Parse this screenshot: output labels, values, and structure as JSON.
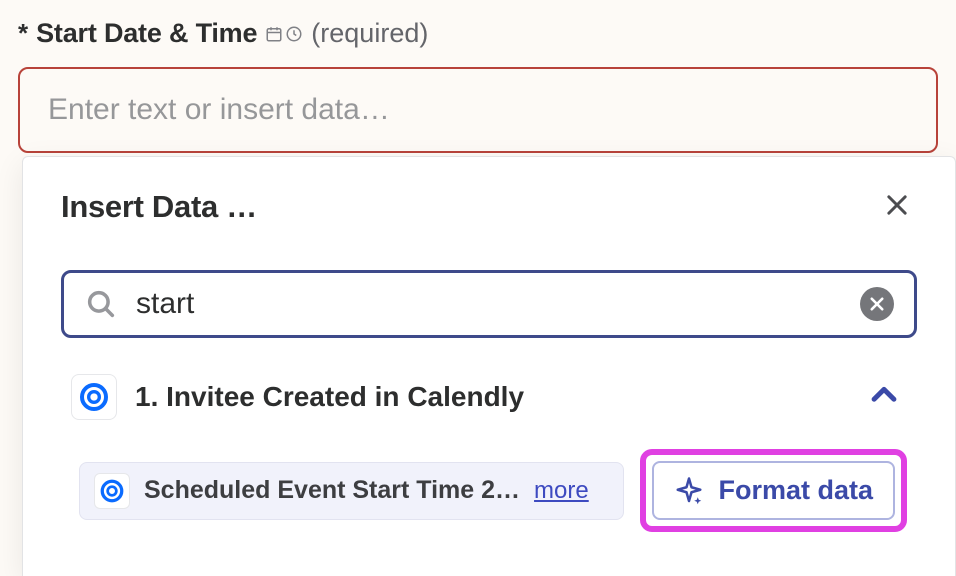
{
  "field": {
    "asterisk": "*",
    "label": "Start Date & Time",
    "required_text": "(required)",
    "placeholder": "Enter text or insert data…"
  },
  "dropdown": {
    "title": "Insert Data …",
    "search_value": "start",
    "group": {
      "title": "1. Invitee Created in Calendly",
      "item_text": "Scheduled Event Start Time 2…",
      "more_label": "more"
    },
    "format_label": "Format data"
  },
  "colors": {
    "highlight": "#e040e2",
    "accent": "#3b4aa8",
    "error_border": "#b8433a"
  }
}
